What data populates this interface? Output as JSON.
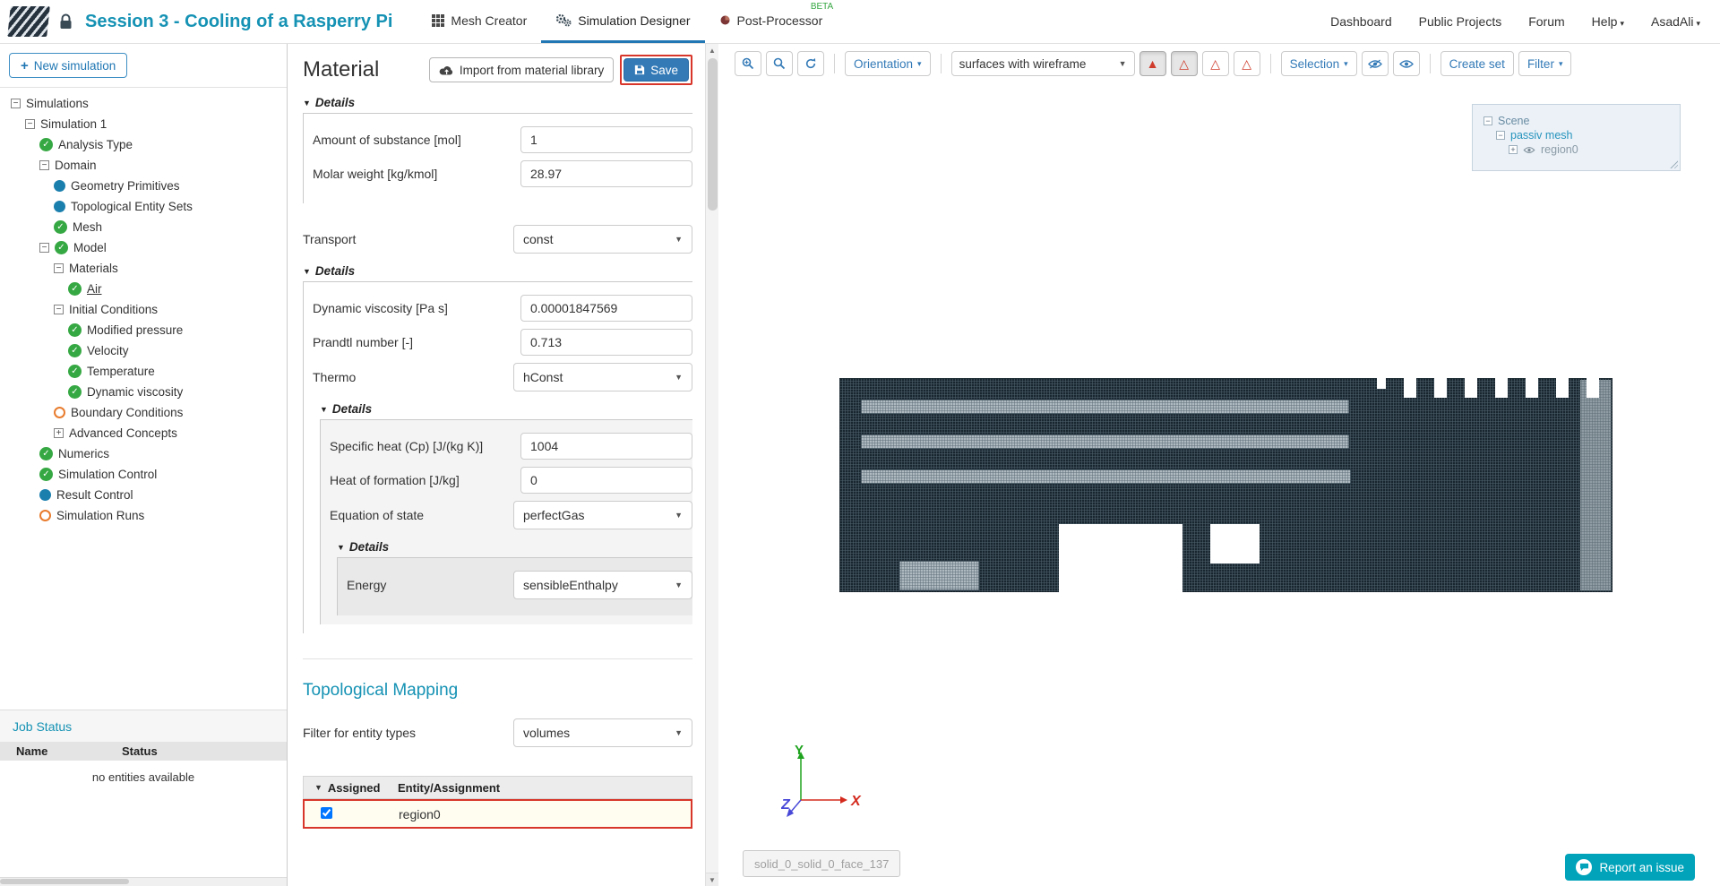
{
  "colors": {
    "brand_teal": "#1592b4",
    "accent_blue": "#337ab7",
    "tab_active_blue": "#2077b4",
    "highlight_red": "#d8362a",
    "success_green": "#36a843",
    "pending_orange": "#e87c2e",
    "info_blue": "#1b7fae",
    "beta_green": "#36a843",
    "report_teal": "#00a3ba",
    "selected_row_yellow": "#fffdf0"
  },
  "icons": {
    "plus": "+",
    "collapse": "−",
    "expand": "+",
    "caret_down": "▾",
    "select_arrow": "▼",
    "sort_desc": "▼",
    "triangle_solid": "▲",
    "triangle_outline": "△",
    "check": "✓",
    "scroll_up": "▲",
    "scroll_down": "▼"
  },
  "header": {
    "project_title": "Session 3 - Cooling of a Rasperry Pi",
    "tabs": [
      {
        "label": "Mesh Creator",
        "active": false
      },
      {
        "label": "Simulation Designer",
        "active": true
      },
      {
        "label": "Post-Processor",
        "active": false,
        "beta": "BETA"
      }
    ],
    "links": {
      "dashboard": "Dashboard",
      "public_projects": "Public Projects",
      "forum": "Forum",
      "help": "Help",
      "user": "AsadAli"
    }
  },
  "sidebar": {
    "new_simulation_label": "New simulation",
    "tree": [
      {
        "label": "Simulations",
        "level": 0,
        "expander": "minus",
        "icon": "none"
      },
      {
        "label": "Simulation 1",
        "level": 1,
        "expander": "minus",
        "icon": "none"
      },
      {
        "label": "Analysis Type",
        "level": 2,
        "expander": "none",
        "icon": "check"
      },
      {
        "label": "Domain",
        "level": 2,
        "expander": "minus",
        "icon": "none"
      },
      {
        "label": "Geometry Primitives",
        "level": 3,
        "expander": "none",
        "icon": "dot-blue"
      },
      {
        "label": "Topological Entity Sets",
        "level": 3,
        "expander": "none",
        "icon": "dot-blue"
      },
      {
        "label": "Mesh",
        "level": 3,
        "expander": "none",
        "icon": "check"
      },
      {
        "label": "Model",
        "level": 2,
        "expander": "minus",
        "icon": "check"
      },
      {
        "label": "Materials",
        "level": 3,
        "expander": "minus",
        "icon": "none"
      },
      {
        "label": "Air",
        "level": 4,
        "expander": "none",
        "icon": "check",
        "selected": true
      },
      {
        "label": "Initial Conditions",
        "level": 3,
        "expander": "minus",
        "icon": "none"
      },
      {
        "label": "Modified pressure",
        "level": 4,
        "expander": "none",
        "icon": "check"
      },
      {
        "label": "Velocity",
        "level": 4,
        "expander": "none",
        "icon": "check"
      },
      {
        "label": "Temperature",
        "level": 4,
        "expander": "none",
        "icon": "check"
      },
      {
        "label": "Dynamic viscosity",
        "level": 4,
        "expander": "none",
        "icon": "check"
      },
      {
        "label": "Boundary Conditions",
        "level": 3,
        "expander": "none",
        "icon": "dot-orange"
      },
      {
        "label": "Advanced Concepts",
        "level": 3,
        "expander": "plus",
        "icon": "none"
      },
      {
        "label": "Numerics",
        "level": 2,
        "expander": "none",
        "icon": "check"
      },
      {
        "label": "Simulation Control",
        "level": 2,
        "expander": "none",
        "icon": "check"
      },
      {
        "label": "Result Control",
        "level": 2,
        "expander": "none",
        "icon": "dot-blue"
      },
      {
        "label": "Simulation Runs",
        "level": 2,
        "expander": "none",
        "icon": "dot-orange"
      }
    ],
    "job_status": {
      "title": "Job Status",
      "columns": [
        "Name",
        "Status"
      ],
      "empty_message": "no entities available"
    }
  },
  "material": {
    "title": "Material",
    "import_label": "Import from material library",
    "save_label": "Save",
    "details_label": "Details",
    "fields": {
      "amount_of_substance": {
        "label": "Amount of substance [mol]",
        "value": "1"
      },
      "molar_weight": {
        "label": "Molar weight [kg/kmol]",
        "value": "28.97"
      },
      "transport": {
        "label": "Transport",
        "value": "const"
      },
      "dynamic_viscosity": {
        "label": "Dynamic viscosity [Pa s]",
        "value": "0.00001847569"
      },
      "prandtl_number": {
        "label": "Prandtl number [-]",
        "value": "0.713"
      },
      "thermo": {
        "label": "Thermo",
        "value": "hConst"
      },
      "specific_heat": {
        "label": "Specific heat (Cp) [J/(kg K)]",
        "value": "1004"
      },
      "heat_of_formation": {
        "label": "Heat of formation [J/kg]",
        "value": "0"
      },
      "equation_of_state": {
        "label": "Equation of state",
        "value": "perfectGas"
      },
      "energy": {
        "label": "Energy",
        "value": "sensibleEnthalpy"
      }
    },
    "topological_mapping": {
      "title": "Topological Mapping",
      "filter_label": "Filter for entity types",
      "filter_value": "volumes",
      "table": {
        "columns": [
          "Assigned",
          "Entity/Assignment"
        ],
        "rows": [
          {
            "assigned": true,
            "entity": "region0"
          }
        ]
      }
    }
  },
  "viewport": {
    "toolbar": {
      "orientation_label": "Orientation",
      "render_mode": "surfaces with wireframe",
      "selection_label": "Selection",
      "create_set_label": "Create set",
      "filter_label": "Filter"
    },
    "scene_tree": {
      "scene": "Scene",
      "mesh": "passiv mesh",
      "region": "region0"
    },
    "axes": {
      "x": "X",
      "y": "Y",
      "z": "Z"
    },
    "tooltip": "solid_0_solid_0_face_137",
    "report_issue_label": "Report an issue"
  }
}
